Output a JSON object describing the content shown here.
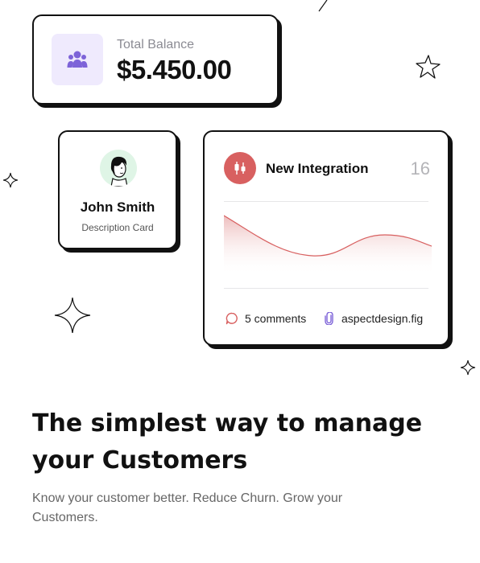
{
  "balance_card": {
    "icon": "users-icon",
    "label": "Total Balance",
    "value": "$5.450.00"
  },
  "profile_card": {
    "avatar": "avatar-illustration",
    "name": "John Smith",
    "description": "Description Card"
  },
  "integration_card": {
    "icon": "candlestick-icon",
    "title": "New Integration",
    "count": "16",
    "comments_icon": "comment-bubble-icon",
    "comments": "5 comments",
    "file_icon": "paperclip-icon",
    "file_name": "aspectdesign.fig",
    "accent_color": "#d86060"
  },
  "hero": {
    "headline_line1": "The simplest way to manage",
    "headline_line2": "your Customers",
    "subtext": "Know your customer better. Reduce Churn. Grow your Customers."
  },
  "colors": {
    "icon_bg": "#efeafd",
    "icon_fg": "#7d63d8",
    "avatar_bg": "#dff5e6"
  }
}
